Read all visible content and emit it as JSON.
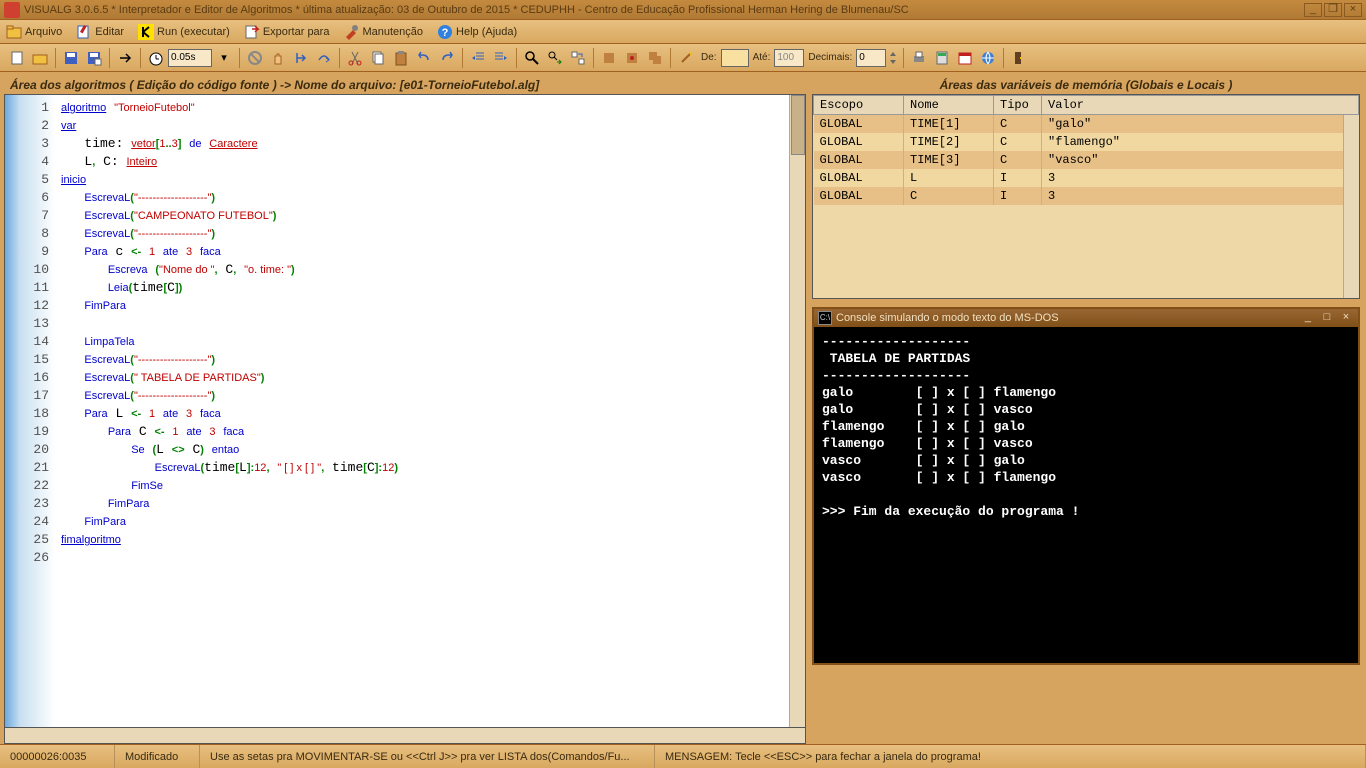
{
  "title": "VISUALG 3.0.6.5 * Interpretador e Editor de Algoritmos * última atualização: 03 de Outubro de 2015 * CEDUPHH - Centro de Educação Profissional Herman Hering de Blumenau/SC",
  "menu": {
    "arquivo": "Arquivo",
    "editar": "Editar",
    "run": "Run (executar)",
    "exportar": "Exportar para",
    "manutencao": "Manutenção",
    "help": "Help (Ajuda)"
  },
  "toolbar": {
    "speed": "0.05s",
    "de": "De:",
    "de_val": "",
    "ate": "Até:",
    "ate_val": "100",
    "decimais": "Decimais:",
    "dec_val": "0"
  },
  "editor": {
    "title": "Área dos algoritmos ( Edição do código fonte ) -> Nome do arquivo: [e01-TorneioFutebol.alg]"
  },
  "vars": {
    "title": "Áreas das variáveis de memória (Globais e Locais )",
    "headers": {
      "escopo": "Escopo",
      "nome": "Nome",
      "tipo": "Tipo",
      "valor": "Valor"
    },
    "rows": [
      {
        "escopo": "GLOBAL",
        "nome": "TIME[1]",
        "tipo": "C",
        "valor": "\"galo\""
      },
      {
        "escopo": "GLOBAL",
        "nome": "TIME[2]",
        "tipo": "C",
        "valor": "\"flamengo\""
      },
      {
        "escopo": "GLOBAL",
        "nome": "TIME[3]",
        "tipo": "C",
        "valor": "\"vasco\""
      },
      {
        "escopo": "GLOBAL",
        "nome": "L",
        "tipo": "I",
        "valor": "3"
      },
      {
        "escopo": "GLOBAL",
        "nome": "C",
        "tipo": "I",
        "valor": "3"
      }
    ]
  },
  "console": {
    "title": "Console simulando o modo texto do MS-DOS",
    "body": "-------------------\n TABELA DE PARTIDAS\n-------------------\ngalo        [ ] x [ ] flamengo\ngalo        [ ] x [ ] vasco\nflamengo    [ ] x [ ] galo\nflamengo    [ ] x [ ] vasco\nvasco       [ ] x [ ] galo\nvasco       [ ] x [ ] flamengo\n\n>>> Fim da execução do programa !"
  },
  "status": {
    "pos": "00000026:0035",
    "mod": "Modificado",
    "hint": "Use as setas pra MOVIMENTAR-SE ou <<Ctrl J>> pra ver LISTA dos(Comandos/Fu...",
    "msg": "MENSAGEM: Tecle <<ESC>>  para fechar a janela do programa!"
  }
}
